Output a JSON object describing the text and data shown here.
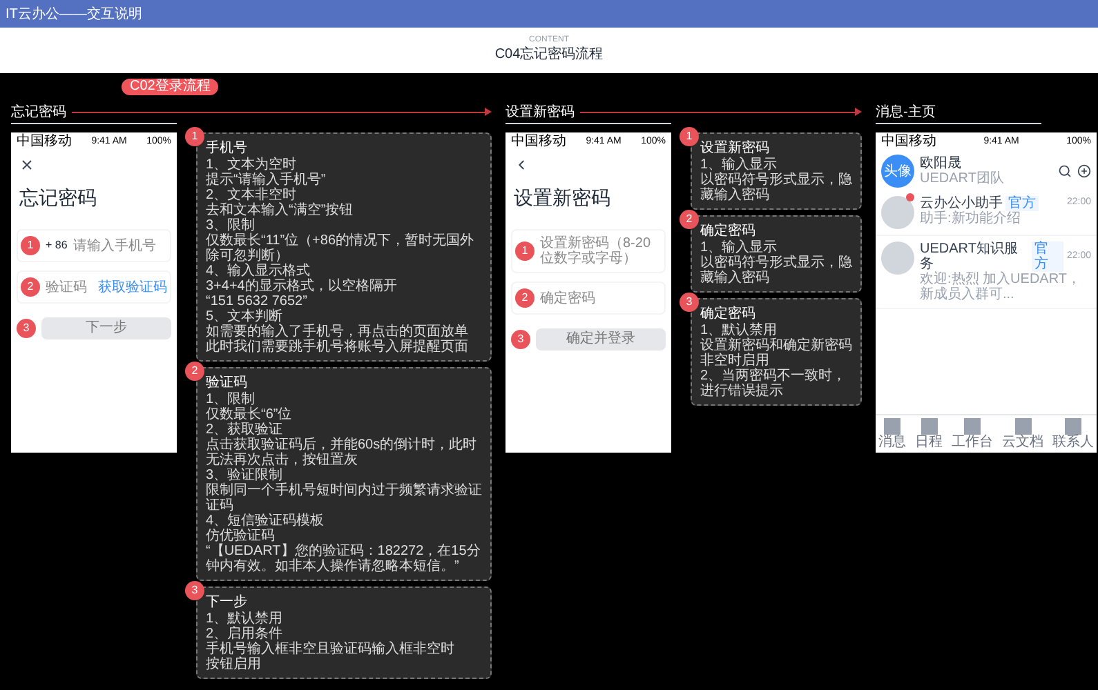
{
  "header": {
    "title": "IT云办公——交互说明"
  },
  "page": {
    "eyebrow": "CONTENT",
    "title": "C04忘记密码流程"
  },
  "flow_tag": "C02登录流程",
  "sections": [
    {
      "title": "忘记密码",
      "screen": {
        "kind": "form",
        "status": {
          "carrier": "中国移动",
          "time": "9:41 AM",
          "battery": "100%"
        },
        "nav": {
          "kind": "close"
        },
        "heading": "忘记密码",
        "fields": [
          {
            "marker": "1",
            "prefix": "+ 86",
            "placeholder": "请输入手机号"
          },
          {
            "marker": "2",
            "placeholder": "验证码",
            "action": "获取验证码"
          }
        ],
        "button": {
          "marker": "3",
          "label": "下一步",
          "disabled": true
        }
      },
      "notes": [
        {
          "marker": "1",
          "title": "手机号",
          "lines": [
            "1、文本为空时",
            "提示“请输入手机号”",
            "2、文本非空时",
            "去和文本输入“满空”按钮",
            "3、限制",
            "仅数最长“11”位（+86的情况下，暂时无国外除可忽判断）",
            "4、输入显示格式",
            "3+4+4的显示格式，以空格隔开",
            "“151 5632 7652”",
            "5、文本判断",
            "如需要的输入了手机号，再点击的页面放单",
            "此时我们需要跳手机号将账号入屏提醒页面"
          ]
        },
        {
          "marker": "2",
          "title": "验证码",
          "lines": [
            "1、限制",
            "仅数最长“6”位",
            "2、获取验证",
            "点击获取验证码后，并能60s的倒计时，此时无法再次点击，按钮置灰",
            "3、验证限制",
            "限制同一个手机号短时间内过于频繁请求验证证码",
            "4、短信验证码模板",
            "仿优验证码",
            "“【UEDART】您的验证码：182272，在15分钟内有效。如非本人操作请忽略本短信。”"
          ]
        },
        {
          "marker": "3",
          "title": "下一步",
          "lines": [
            "1、默认禁用",
            "2、启用条件",
            "手机号输入框非空且验证码输入框非空时",
            "按钮启用"
          ]
        }
      ]
    },
    {
      "title": "设置新密码",
      "screen": {
        "kind": "form",
        "status": {
          "carrier": "中国移动",
          "time": "9:41 AM",
          "battery": "100%"
        },
        "nav": {
          "kind": "back"
        },
        "heading": "设置新密码",
        "fields": [
          {
            "marker": "1",
            "placeholder": "设置新密码（8-20位数字或字母）"
          },
          {
            "marker": "2",
            "placeholder": "确定密码"
          }
        ],
        "button": {
          "marker": "3",
          "label": "确定并登录",
          "disabled": true
        }
      },
      "notes": [
        {
          "marker": "1",
          "title": "设置新密码",
          "lines": [
            "1、输入显示",
            "以密码符号形式显示，隐藏输入密码"
          ]
        },
        {
          "marker": "2",
          "title": "确定密码",
          "lines": [
            "1、输入显示",
            "以密码符号形式显示，隐藏输入密码"
          ]
        },
        {
          "marker": "3",
          "title": "确定密码",
          "lines": [
            "1、默认禁用",
            "设置新密码和确定新密码非空时启用",
            "2、当两密码不一致时，进行错误提示"
          ]
        }
      ]
    },
    {
      "title": "消息-主页",
      "screen": {
        "kind": "messages",
        "status": {
          "carrier": "中国移动",
          "time": "9:41 AM",
          "battery": "100%"
        },
        "profile": {
          "avatar": "头像",
          "name": "欧阳晟",
          "team": "UEDART团队"
        },
        "chats": [
          {
            "name": "云办公小助手",
            "tag": "官方",
            "time": "22:00",
            "preview": "助手:新功能介绍",
            "unread": true
          },
          {
            "name": "UEDART知识服务",
            "tag": "官方",
            "time": "22:00",
            "preview": "欢迎:热烈 加入UEDART，新成员入群可...",
            "unread": false
          }
        ],
        "tabs": [
          {
            "label": "消息"
          },
          {
            "label": "日程"
          },
          {
            "label": "工作台"
          },
          {
            "label": "云文档"
          },
          {
            "label": "联系人"
          }
        ]
      }
    }
  ]
}
